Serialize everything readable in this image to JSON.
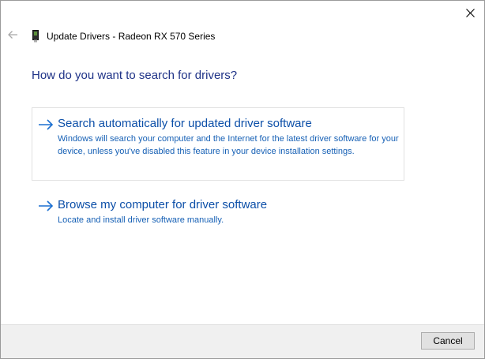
{
  "window": {
    "title": "Update Drivers - Radeon RX 570 Series"
  },
  "question": "How do you want to search for drivers?",
  "options": [
    {
      "title": "Search automatically for updated driver software",
      "description": "Windows will search your computer and the Internet for the latest driver software for your device, unless you've disabled this feature in your device installation settings."
    },
    {
      "title": "Browse my computer for driver software",
      "description": "Locate and install driver software manually."
    }
  ],
  "footer": {
    "cancel_label": "Cancel"
  },
  "icons": {
    "close": "close-icon",
    "back": "back-arrow-icon",
    "device": "display-adapter-icon",
    "option_arrow": "arrow-right-icon"
  },
  "colors": {
    "heading": "#1e3287",
    "link": "#0c4fa8",
    "link_desc": "#1660b5",
    "arrow": "#1a6fd1",
    "footer_bg": "#f0f0f0"
  }
}
